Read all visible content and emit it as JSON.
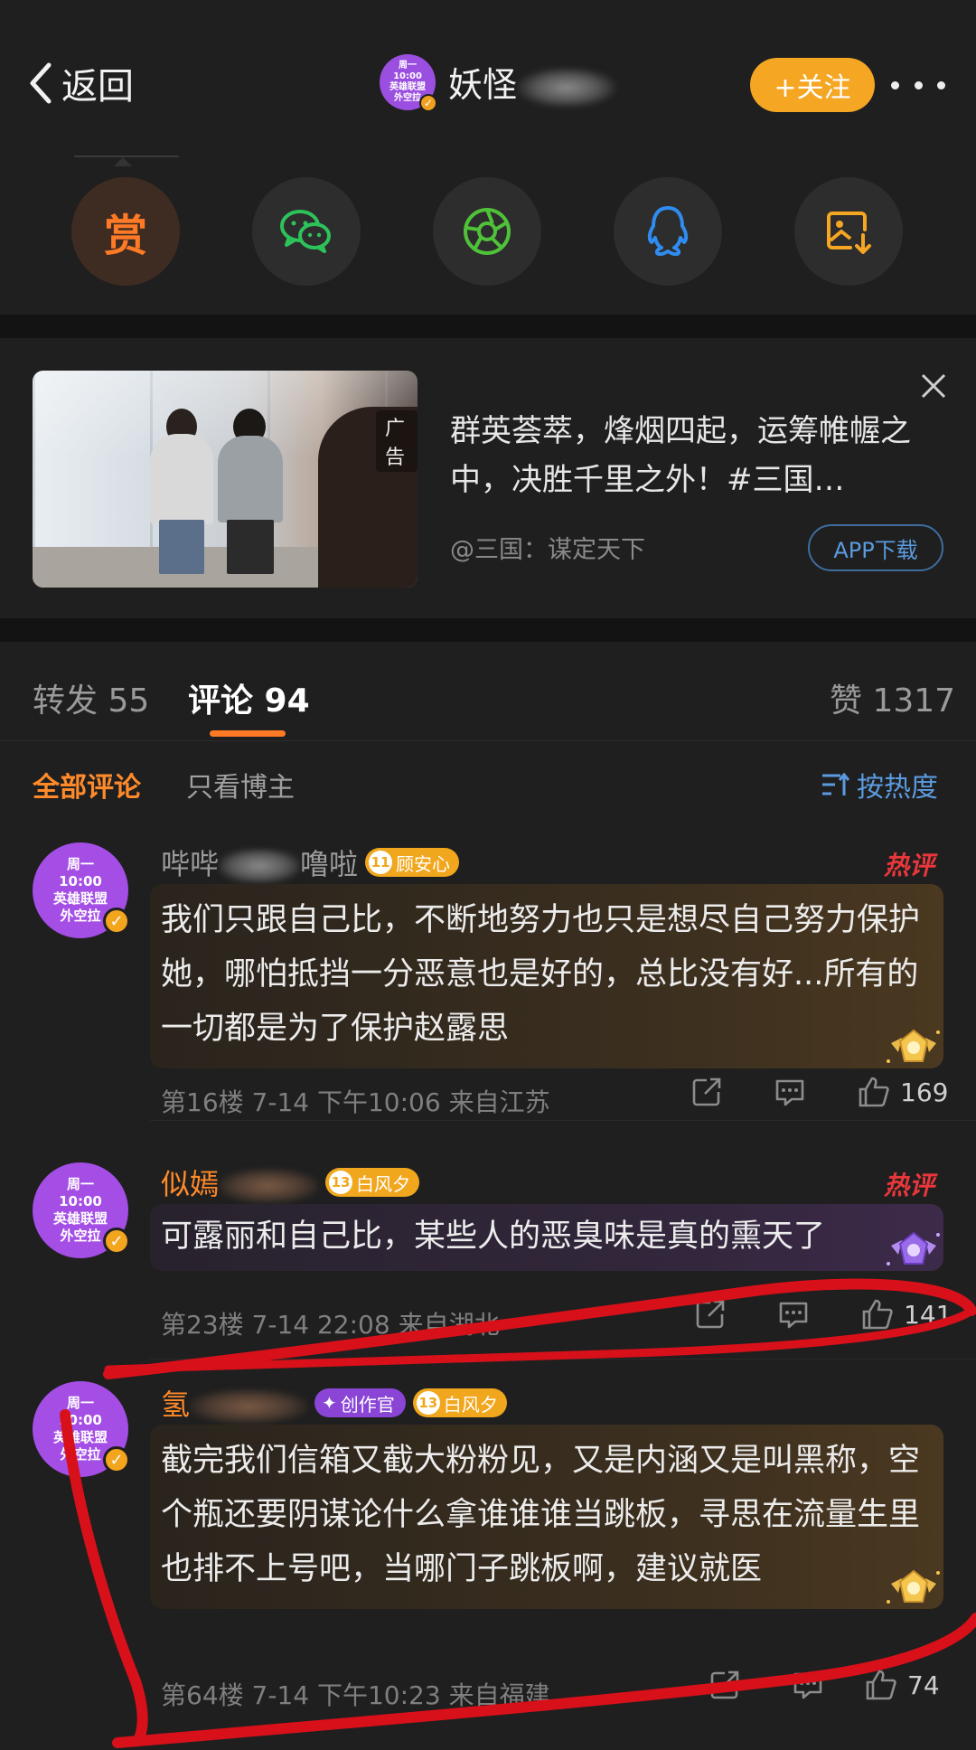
{
  "topbar": {
    "back_label": "返回",
    "avatar_lines": [
      "周一",
      "10:00",
      "英雄联盟",
      "外空拉"
    ],
    "username_visible": "妖怪",
    "follow_label": "+关注"
  },
  "share": {
    "reward_label": "赏",
    "buttons": [
      "reward-button",
      "wechat-share-button",
      "moments-share-button",
      "qq-share-button",
      "save-image-button"
    ]
  },
  "ad": {
    "tag": "广告",
    "title": "群英荟萃，烽烟四起，运筹帷幄之中，决胜千里之外！#三国…",
    "source": "@三国：谋定天下",
    "button": "APP下载"
  },
  "tabs": {
    "repost": "转发 55",
    "comments": "评论 94",
    "likes": "赞 1317"
  },
  "filter": {
    "all": "全部评论",
    "host_only": "只看博主",
    "sort": "按热度"
  },
  "comments": [
    {
      "avatar_lines": [
        "周一",
        "10:00",
        "英雄联盟",
        "外空拉"
      ],
      "name_start": "哔哔",
      "name_end": "噜啦",
      "fan_level": "11",
      "fan_badge": "顾安心",
      "hot": "热评",
      "text": "我们只跟自己比，不断地努力也只是想尽自己努力保护她，哪怕抵挡一分恶意也是好的，总比没有好...所有的一切都是为了保护赵露思",
      "meta": "第16楼  7-14  下午10:06  来自江苏",
      "likes": "169"
    },
    {
      "avatar_lines": [
        "周一",
        "10:00",
        "英雄联盟",
        "外空拉"
      ],
      "name_start": "似嫣",
      "fan_level": "13",
      "fan_badge": "白风夕",
      "hot": "热评",
      "text": "可露丽和自己比，某些人的恶臭味是真的熏天了",
      "meta": "第23楼  7-14  22:08  来自湖北",
      "likes": "141"
    },
    {
      "avatar_lines": [
        "周一",
        "10:00",
        "英雄联盟",
        "外空拉"
      ],
      "name_start": "氢",
      "creator_badge": "创作官",
      "fan_level": "13",
      "fan_badge": "白风夕",
      "text": "截完我们信箱又截大粉粉见，又是内涵又是叫黑称，空个瓶还要阴谋论什么拿谁谁谁当跳板，寻思在流量生里也排不上号吧，当哪门子跳板啊，建议就医",
      "meta": "第64楼  7-14  下午10:23  来自福建",
      "likes": "74"
    }
  ],
  "colors": {
    "accent_orange": "#ff7a26",
    "follow_bg": "#f5a623",
    "link_blue": "#5b9be0",
    "hot_red": "#e8373b",
    "annotation_red": "#d8101a"
  }
}
